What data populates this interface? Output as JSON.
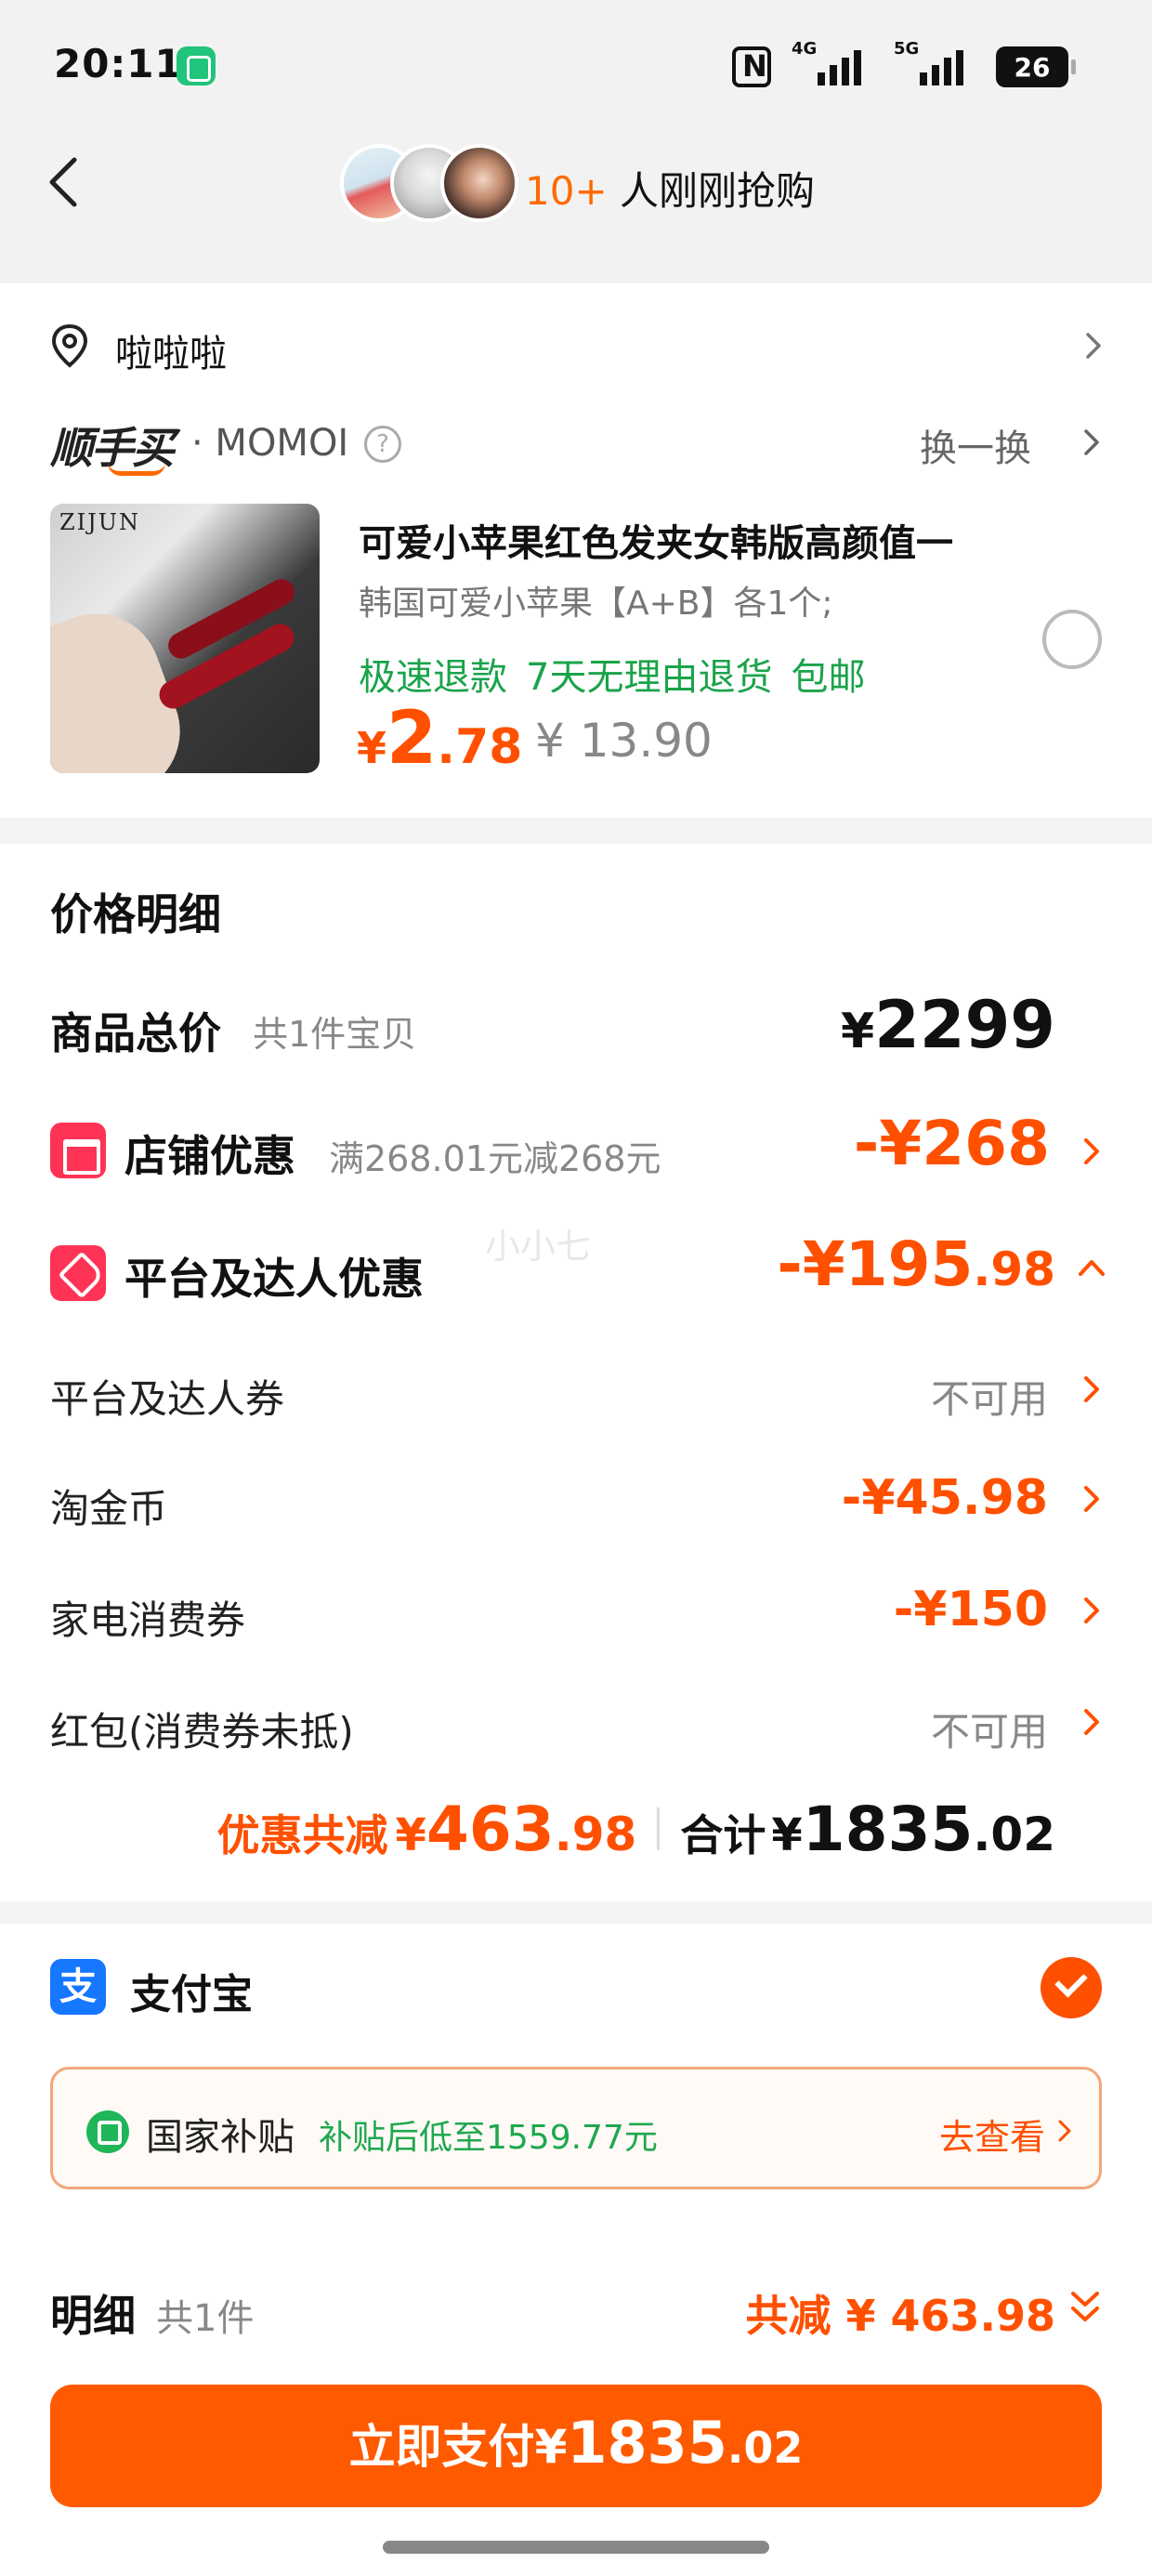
{
  "status": {
    "time": "20:11",
    "net1": "4G",
    "net2": "5G",
    "battery": "26"
  },
  "header": {
    "count": "10+",
    "text": " 人刚刚抢购"
  },
  "address": {
    "text": "啦啦啦"
  },
  "shop": {
    "logo": "顺手买",
    "name": "· MOMOI",
    "swap": "换一换"
  },
  "product": {
    "image_brand": "ZIJUN",
    "title": "可爱小苹果红色发夹女韩版高颜值一",
    "sku": "韩国可爱小苹果【A+B】各1个;",
    "tags": [
      "极速退款",
      "7天无理由退货",
      "包邮"
    ],
    "price_cur": "¥",
    "price_int": "2",
    "price_dec": ".78",
    "orig_price": "¥ 13.90"
  },
  "price_detail": {
    "title": "价格明细",
    "goods_total_label": "商品总价",
    "goods_total_sub": "共1件宝贝",
    "goods_total_cur": "¥",
    "goods_total_val": "2299",
    "shop_discount_label": "店铺优惠",
    "shop_discount_sub": "满268.01元减268元",
    "shop_discount_val": "-¥268",
    "platform_label": "平台及达人优惠",
    "platform_val_int": "-¥195",
    "platform_val_dec": ".98",
    "watermark": "小小七",
    "rows": [
      {
        "label": "平台及达人券",
        "value": "不可用"
      },
      {
        "label": "淘金币",
        "value": "-¥45.98"
      },
      {
        "label": "家电消费券",
        "value": "-¥150"
      },
      {
        "label": "红包(消费券未抵)",
        "value": "不可用"
      }
    ],
    "discount_total_label": "优惠共减",
    "discount_total_cur": "¥",
    "discount_total_int": "463",
    "discount_total_dec": ".98",
    "sum_label": "合计",
    "sum_cur": "¥",
    "sum_int": "1835",
    "sum_dec": ".02"
  },
  "payment": {
    "method_icon": "支",
    "method_label": "支付宝",
    "subsidy_title": "国家补贴",
    "subsidy_desc": "补贴后低至1559.77元",
    "subsidy_link": "去查看",
    "detail_label": "明细",
    "detail_sub": "共1件",
    "detail_total": "共减 ¥ 463.98",
    "pay_label": "立即支付",
    "pay_cur": "¥",
    "pay_int": "1835",
    "pay_dec": ".02"
  },
  "colors": {
    "accent": "#ff5000",
    "green": "#1fa84f",
    "alipay": "#1677ff"
  }
}
